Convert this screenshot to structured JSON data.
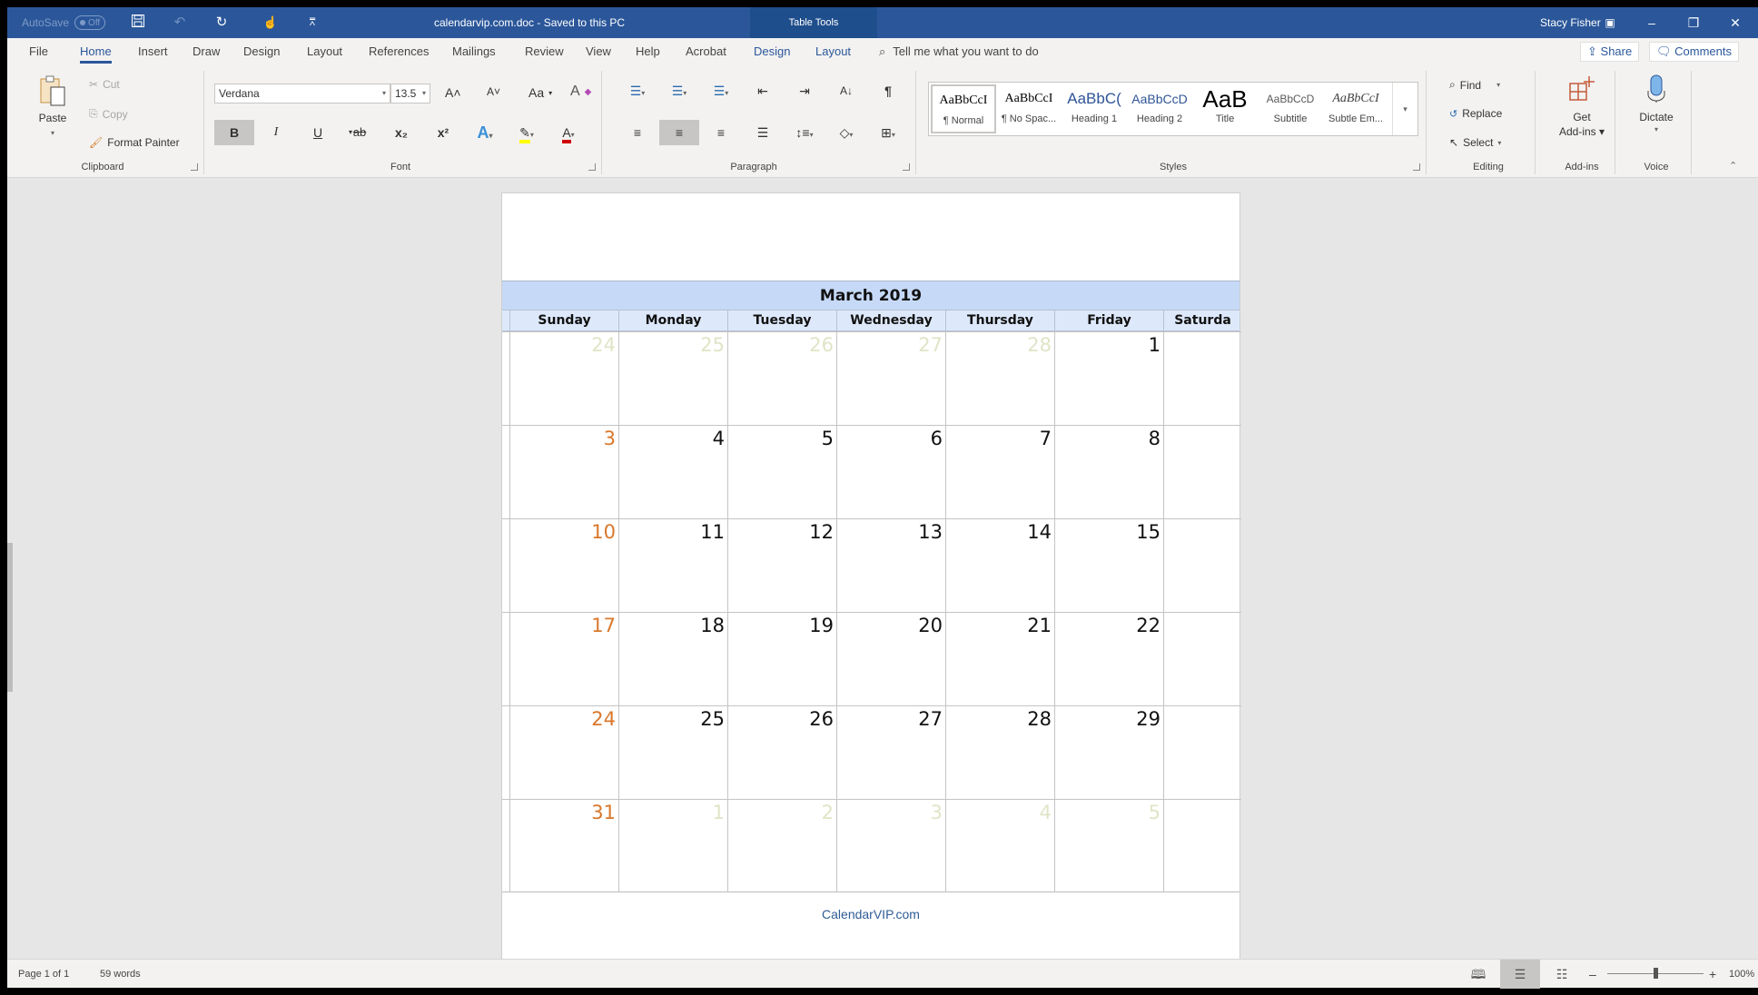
{
  "titlebar": {
    "autosave_label": "AutoSave",
    "autosave_state": "Off",
    "doc_title": "calendarvip.com.doc  -  Saved to this PC",
    "context_tab_group": "Table Tools",
    "user_name": "Stacy Fisher",
    "icons": [
      "save-icon",
      "undo-icon",
      "redo-icon",
      "touch-mode-icon",
      "customize-qat-icon",
      "ribbon-display-options-icon",
      "minimize-icon",
      "restore-icon",
      "close-icon"
    ]
  },
  "tabs": [
    {
      "label": "File"
    },
    {
      "label": "Home",
      "active": true
    },
    {
      "label": "Insert"
    },
    {
      "label": "Draw"
    },
    {
      "label": "Design"
    },
    {
      "label": "Layout"
    },
    {
      "label": "References"
    },
    {
      "label": "Mailings"
    },
    {
      "label": "Review"
    },
    {
      "label": "View"
    },
    {
      "label": "Help"
    },
    {
      "label": "Acrobat"
    },
    {
      "label": "Design",
      "contextual": true
    },
    {
      "label": "Layout",
      "contextual": true
    }
  ],
  "tell_me": "Tell me what you want to do",
  "share_label": "Share",
  "comments_label": "Comments",
  "ribbon": {
    "clipboard": {
      "label": "Clipboard",
      "paste": "Paste",
      "cut": "Cut",
      "copy": "Copy",
      "format_painter": "Format Painter"
    },
    "font": {
      "label": "Font",
      "font_name": "Verdana",
      "font_size": "13.5",
      "grow": "A˄",
      "shrink": "A˅",
      "change_case": "Aa",
      "bold": "B",
      "italic": "I",
      "underline": "U",
      "strike": "ab",
      "subscript": "x₂",
      "superscript": "x²",
      "highlight_color": "#ffff00",
      "font_color": "#d00000"
    },
    "paragraph": {
      "label": "Paragraph",
      "pilcrow": "¶"
    },
    "styles": {
      "label": "Styles",
      "items": [
        {
          "preview": "AaBbCcI",
          "name": "¶ Normal",
          "selected": true
        },
        {
          "preview": "AaBbCcI",
          "name": "¶ No Spac..."
        },
        {
          "preview": "AaBbC(",
          "name": "Heading 1"
        },
        {
          "preview": "AaBbCcD",
          "name": "Heading 2"
        },
        {
          "preview": "AaB",
          "name": "Title"
        },
        {
          "preview": "AaBbCcD",
          "name": "Subtitle"
        },
        {
          "preview": "AaBbCcI",
          "name": "Subtle Em..."
        }
      ]
    },
    "editing": {
      "label": "Editing",
      "find": "Find",
      "replace": "Replace",
      "select": "Select"
    },
    "addins": {
      "label": "Add-ins",
      "get_addins_1": "Get",
      "get_addins_2": "Add-ins"
    },
    "voice": {
      "label": "Voice",
      "dictate": "Dictate"
    }
  },
  "calendar": {
    "title": "March 2019",
    "days": [
      "Sunday",
      "Monday",
      "Tuesday",
      "Wednesday",
      "Thursday",
      "Friday",
      "Saturda"
    ],
    "weeks": [
      [
        {
          "d": "24",
          "o": true
        },
        {
          "d": "25",
          "o": true
        },
        {
          "d": "26",
          "o": true
        },
        {
          "d": "27",
          "o": true
        },
        {
          "d": "28",
          "o": true
        },
        {
          "d": "1"
        },
        {
          "d": ""
        }
      ],
      [
        {
          "d": "3"
        },
        {
          "d": "4"
        },
        {
          "d": "5"
        },
        {
          "d": "6"
        },
        {
          "d": "7"
        },
        {
          "d": "8"
        },
        {
          "d": ""
        }
      ],
      [
        {
          "d": "10"
        },
        {
          "d": "11"
        },
        {
          "d": "12"
        },
        {
          "d": "13"
        },
        {
          "d": "14"
        },
        {
          "d": "15"
        },
        {
          "d": ""
        }
      ],
      [
        {
          "d": "17"
        },
        {
          "d": "18"
        },
        {
          "d": "19"
        },
        {
          "d": "20"
        },
        {
          "d": "21"
        },
        {
          "d": "22"
        },
        {
          "d": ""
        }
      ],
      [
        {
          "d": "24"
        },
        {
          "d": "25"
        },
        {
          "d": "26"
        },
        {
          "d": "27"
        },
        {
          "d": "28"
        },
        {
          "d": "29"
        },
        {
          "d": ""
        }
      ],
      [
        {
          "d": "31"
        },
        {
          "d": "1",
          "o": true
        },
        {
          "d": "2",
          "o": true
        },
        {
          "d": "3",
          "o": true
        },
        {
          "d": "4",
          "o": true
        },
        {
          "d": "5",
          "o": true
        },
        {
          "d": ""
        }
      ]
    ],
    "footer": "CalendarVIP.com",
    "colors": {
      "header_band": "#c6d9f7",
      "dayname_band": "#dde9fb",
      "sunday": "#d9772b",
      "other_month": "#dfe5c6"
    }
  },
  "status": {
    "page": "Page 1 of 1",
    "words": "59 words",
    "zoom": "100%",
    "zoom_percent": 100
  }
}
